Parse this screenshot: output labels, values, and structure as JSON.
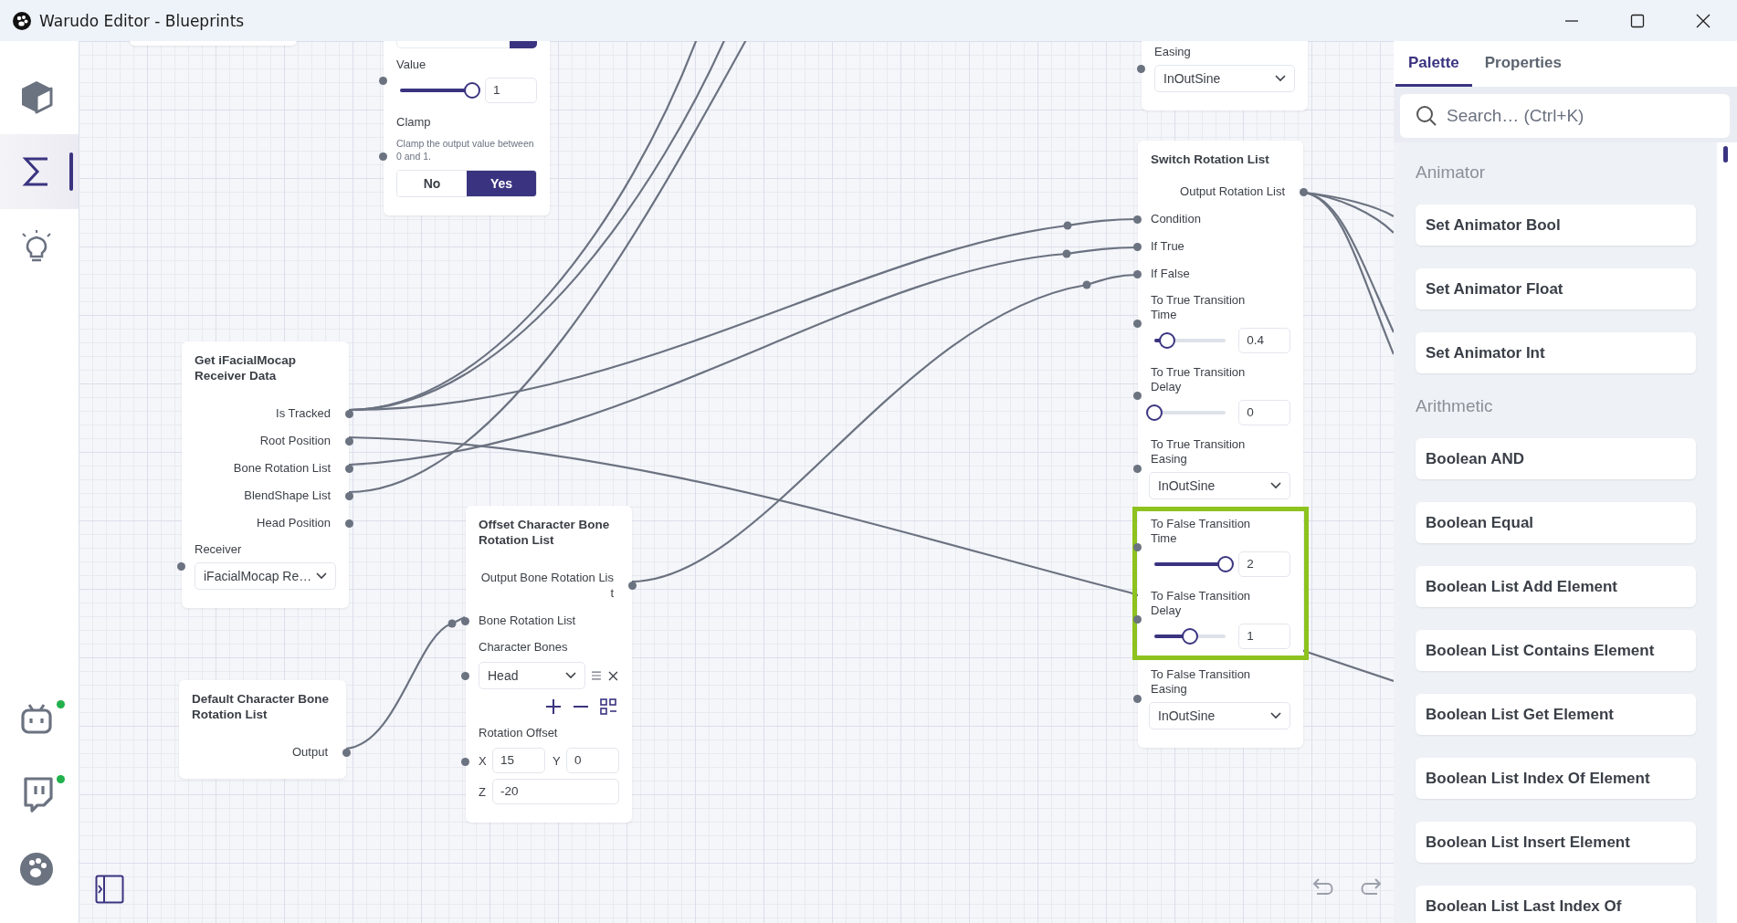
{
  "window": {
    "title": "Warudo Editor - Blueprints"
  },
  "sidebar": {
    "top_items": [
      {
        "selected": false
      },
      {
        "selected": true
      },
      {
        "selected": false
      }
    ],
    "bottom_items": [
      {
        "online": true
      },
      {
        "online": true
      },
      {
        "online": false
      }
    ]
  },
  "nodes": [
    {
      "rows": [
        {
          "kind": "clipped-field"
        },
        {
          "kind": "slider",
          "label": "Value",
          "level": 1,
          "value": "1"
        },
        {
          "kind": "toggle",
          "label": "Clamp",
          "description": "Clamp the output value between 0 and 1.",
          "options": [
            {
              "label": "No",
              "selected": false
            },
            {
              "label": "Yes",
              "selected": true
            }
          ]
        }
      ]
    },
    {
      "rows": [
        {
          "kind": "dropdown",
          "label": "Easing",
          "value": "InOutSine"
        }
      ]
    },
    {
      "title": "Switch Rotation List",
      "rows": [
        {
          "kind": "output",
          "label": "Output Rotation List",
          "highlighted": false
        },
        {
          "kind": "input",
          "label": "Condition",
          "highlighted": false
        },
        {
          "kind": "input",
          "label": "If True",
          "highlighted": false
        },
        {
          "kind": "input",
          "label": "If False",
          "highlighted": false
        },
        {
          "kind": "slider",
          "label": "To True Transition Time",
          "level": 0.18,
          "value": "0.4",
          "highlighted": false
        },
        {
          "kind": "slider",
          "label": "To True Transition Delay",
          "level": 0,
          "value": "0",
          "highlighted": false
        },
        {
          "kind": "dropdown",
          "label": "To True Transition Easing",
          "value": "InOutSine",
          "highlighted": false
        },
        {
          "kind": "slider",
          "label": "To False Transition Time",
          "level": 1,
          "value": "2",
          "highlighted": true
        },
        {
          "kind": "slider",
          "label": "To False Transition Delay",
          "level": 0.5,
          "value": "1",
          "highlighted": true
        },
        {
          "kind": "dropdown",
          "label": "To False Transition Easing",
          "value": "InOutSine",
          "highlighted": false
        }
      ]
    },
    {
      "title": "Get iFacialMocap Receiver Data",
      "rows": [
        {
          "kind": "output",
          "label": "Is Tracked"
        },
        {
          "kind": "output",
          "label": "Root Position"
        },
        {
          "kind": "output",
          "label": "Bone Rotation List"
        },
        {
          "kind": "output",
          "label": "BlendShape List"
        },
        {
          "kind": "output",
          "label": "Head Position"
        },
        {
          "kind": "dropdown",
          "label": "Receiver",
          "value": "iFacialMocap Re…"
        }
      ]
    },
    {
      "title": "Offset Character Bone Rotation List",
      "rows": [
        {
          "kind": "output",
          "label": "Output Bone Rotation List"
        },
        {
          "kind": "input",
          "label": "Bone Rotation List"
        },
        {
          "kind": "list",
          "label": "Character Bones",
          "items": [
            "Head"
          ]
        },
        {
          "kind": "vector",
          "label": "Rotation Offset",
          "fields": [
            {
              "axis": "X",
              "value": "15"
            },
            {
              "axis": "Y",
              "value": "0"
            },
            {
              "axis": "Z",
              "value": "-20"
            }
          ]
        }
      ]
    },
    {
      "title": "Default Character Bone Rotation List",
      "rows": [
        {
          "kind": "output",
          "label": "Output"
        }
      ]
    }
  ],
  "panel": {
    "tabs": [
      {
        "label": "Palette",
        "selected": true
      },
      {
        "label": "Properties",
        "selected": false
      }
    ],
    "search": {
      "placeholder": "Search… (Ctrl+K)"
    },
    "groups": [
      {
        "title": "Animator",
        "items": [
          "Set Animator Bool",
          "Set Animator Float",
          "Set Animator Int"
        ]
      },
      {
        "title": "Arithmetic",
        "items": [
          "Boolean AND",
          "Boolean Equal",
          "Boolean List Add Element",
          "Boolean List Contains Element",
          "Boolean List Get Element",
          "Boolean List Index Of Element",
          "Boolean List Insert Element",
          "Boolean List Last Index Of"
        ]
      }
    ]
  }
}
